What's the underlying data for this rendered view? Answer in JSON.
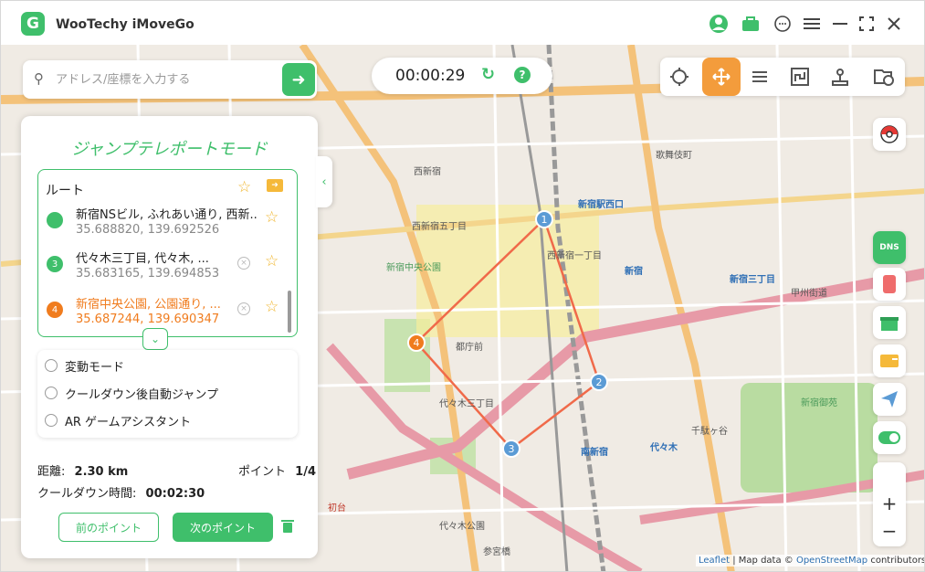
{
  "app": {
    "title": "WooTechy iMoveGo",
    "logo_letter": "G"
  },
  "search": {
    "placeholder": "アドレス/座標を入力する"
  },
  "timer": {
    "elapsed": "00:00:29"
  },
  "panel": {
    "title": "ジャンプテレポートモード",
    "route_label": "ルート",
    "stops": [
      {
        "marker": "",
        "name": "新宿NSビル, ふれあい通り, 西新...",
        "coords": "35.688820, 139.692526",
        "color": "#3fbf6b"
      },
      {
        "marker": "3",
        "name": "代々木三丁目, 代々木, ...",
        "coords": "35.683165, 139.694853",
        "color": "#3fbf6b"
      },
      {
        "marker": "4",
        "name": "新宿中央公園, 公園通り, ...",
        "coords": "35.687244, 139.690347",
        "color": "#f07c1e"
      }
    ],
    "options": [
      "変動モード",
      "クールダウン後自動ジャンプ",
      "AR ゲームアシスタント"
    ],
    "distance_label": "距離:",
    "distance_value": "2.30 km",
    "point_label": "ポイント",
    "point_value": "1/4",
    "cooldown_label": "クールダウン時間:",
    "cooldown_value": "00:02:30",
    "prev_button": "前のポイント",
    "next_button": "次のポイント"
  },
  "map_labels": [
    {
      "t": "西新宿",
      "cls": "blue"
    },
    {
      "t": "新宿",
      "cls": "blue"
    },
    {
      "t": "南新宿",
      "cls": "blue"
    },
    {
      "t": "代々木",
      "cls": "blue"
    },
    {
      "t": "新宿御苑",
      "cls": "green"
    },
    {
      "t": "代々木三丁目",
      "cls": ""
    },
    {
      "t": "都庁前",
      "cls": ""
    },
    {
      "t": "新宿中央公園",
      "cls": "green"
    },
    {
      "t": "千駄ヶ谷",
      "cls": ""
    },
    {
      "t": "西新宿一丁目",
      "cls": ""
    },
    {
      "t": "新宿駅西口",
      "cls": "blue"
    },
    {
      "t": "代々木公園",
      "cls": ""
    },
    {
      "t": "初台",
      "cls": "red"
    },
    {
      "t": "参宮橋",
      "cls": ""
    },
    {
      "t": "西新宿五丁目",
      "cls": ""
    },
    {
      "t": "歌舞伎町",
      "cls": ""
    },
    {
      "t": "新宿三丁目",
      "cls": "blue"
    },
    {
      "t": "甲州街道",
      "cls": ""
    }
  ],
  "route_points": [
    {
      "label": "1",
      "color": "#5b9bd5"
    },
    {
      "label": "2",
      "color": "#5b9bd5"
    },
    {
      "label": "3",
      "color": "#5b9bd5"
    },
    {
      "label": "4",
      "color": "#f07c1e"
    }
  ],
  "attribution": {
    "leaflet": "Leaflet",
    "sep": " | Map data © ",
    "osm": "OpenStreetMap",
    "tail": " contributors"
  }
}
